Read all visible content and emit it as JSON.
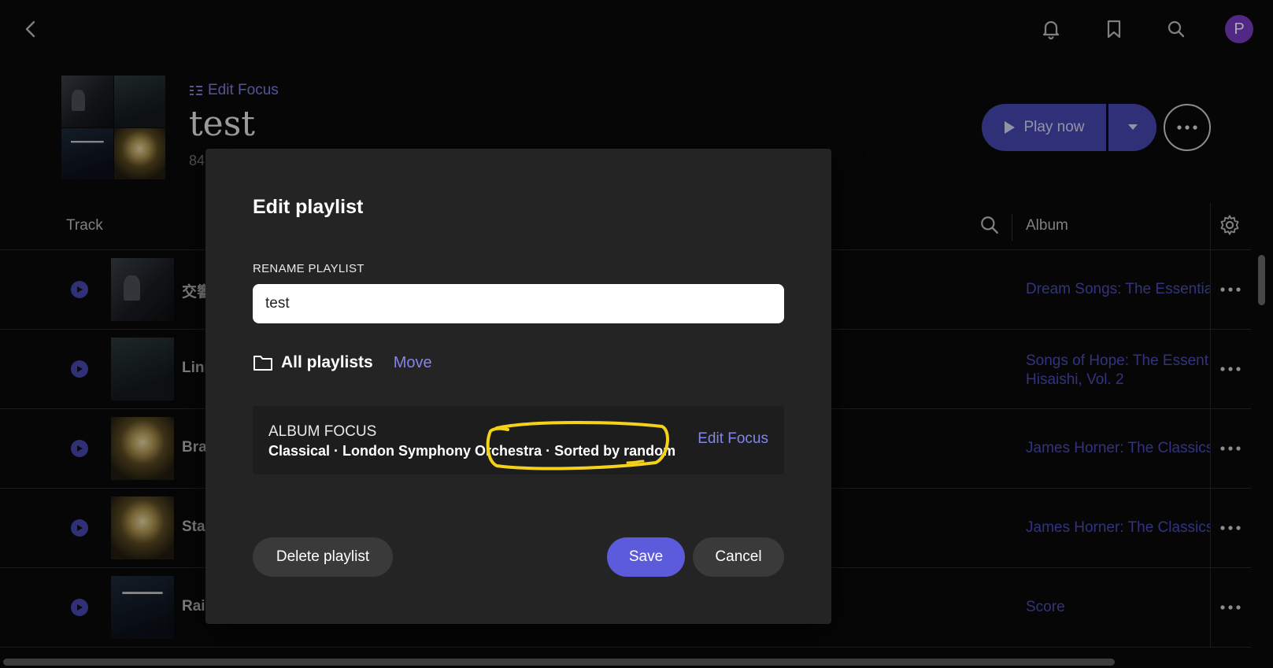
{
  "app": {
    "avatar_initial": "P",
    "accent_color": "#5b5bdc"
  },
  "top_bar": {
    "icons": [
      "back-icon",
      "bell-icon",
      "bookmark-icon",
      "search-icon",
      "avatar"
    ]
  },
  "header": {
    "edit_focus_label": "Edit Focus",
    "title": "test",
    "subtitle_partial": "84",
    "play_now_label": "Play now"
  },
  "table": {
    "headers": {
      "track": "Track",
      "album": "Album"
    },
    "rows": [
      {
        "title_partial": "交響",
        "album": "Dream Songs: The Essentia",
        "cover": "piano"
      },
      {
        "title_partial": "Link",
        "album": "Songs of Hope: The Essent Hisaishi, Vol. 2",
        "cover": "piano2"
      },
      {
        "title_partial": "Bra",
        "album": "James Horner: The Classics",
        "cover": "horner"
      },
      {
        "title_partial": "Sta",
        "album": "James Horner: The Classics",
        "cover": "horner"
      },
      {
        "title_partial": "Rai",
        "album": "Score",
        "cover": "cello"
      }
    ]
  },
  "modal": {
    "title": "Edit playlist",
    "rename_label": "RENAME PLAYLIST",
    "rename_value": "test",
    "folder_label": "All playlists",
    "move_label": "Move",
    "focus_heading": "ALBUM FOCUS",
    "focus_detail": "Classical · London Symphony Orchestra · Sorted by random",
    "focus_edit_label": "Edit Focus",
    "delete_label": "Delete playlist",
    "save_label": "Save",
    "cancel_label": "Cancel",
    "highlight_color": "#f5d21a"
  }
}
